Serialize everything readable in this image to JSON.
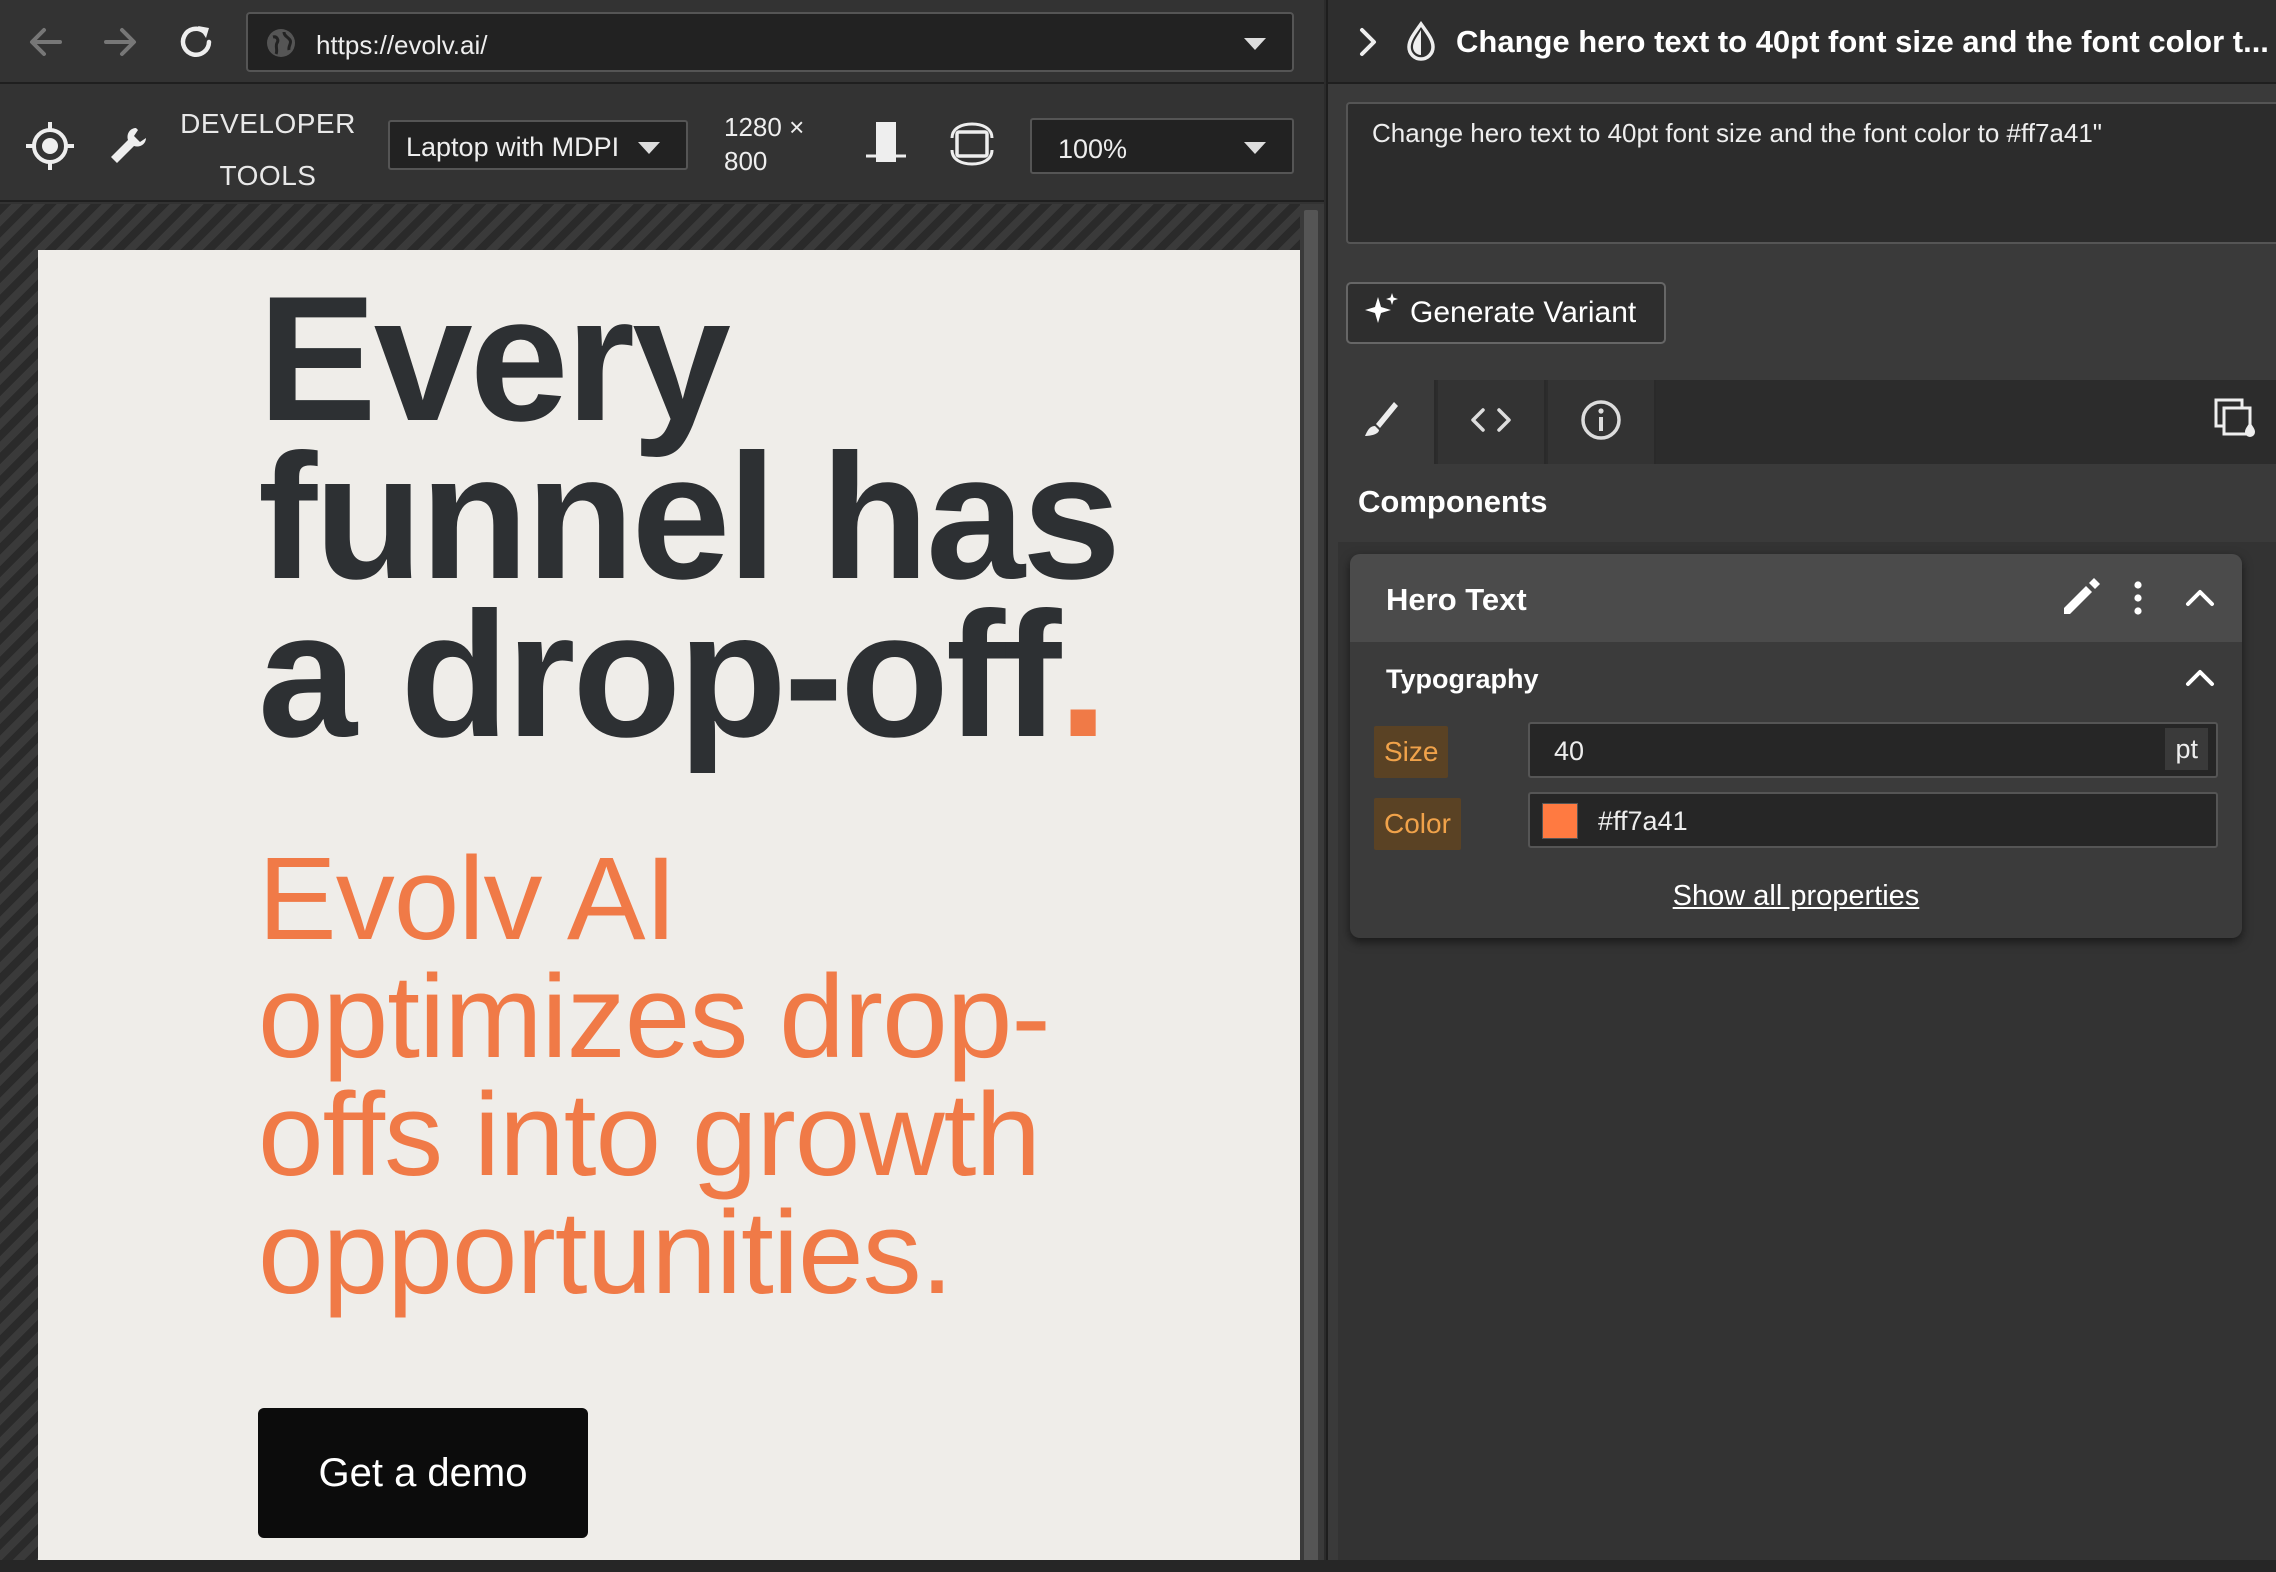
{
  "browser": {
    "url": "https://evolv.ai/"
  },
  "devtools": {
    "title_line1": "DEVELOPER",
    "title_line2": "TOOLS",
    "device": "Laptop with MDPI",
    "width": "1280 ×",
    "height": "800",
    "zoom": "100%"
  },
  "hero": {
    "headline_line1": "Every",
    "headline_line2": "funnel has",
    "headline_line3": "a drop-off",
    "headline_dot": ".",
    "subhead_line1": "Evolv AI",
    "subhead_line2": "optimizes drop-",
    "subhead_line3": "offs into growth",
    "subhead_line4": "opportunities.",
    "cta": "Get a demo"
  },
  "panel": {
    "title": "Change hero text to 40pt font size and the font color t...",
    "prompt": "Change hero text to 40pt font size and the font color to #ff7a41\"",
    "generate_label": "Generate Variant",
    "components_heading": "Components",
    "component": {
      "name": "Hero Text",
      "section": "Typography",
      "size_label": "Size",
      "size_value": "40",
      "size_unit": "pt",
      "color_label": "Color",
      "color_value": "#ff7a41",
      "show_all": "Show all properties"
    }
  },
  "colors": {
    "accent": "#f07a47",
    "swatch": "#ff7a41",
    "headline": "#2d3033",
    "page_bg": "#efede9"
  },
  "icons": [
    "back-arrow-icon",
    "forward-arrow-icon",
    "reload-icon",
    "globe-icon",
    "crosshair-icon",
    "wrench-icon",
    "portrait-icon",
    "rotate-icon",
    "chevron-right-icon",
    "drop-icon",
    "sparkle-icon",
    "brush-icon",
    "code-icon",
    "info-icon",
    "copy-style-icon",
    "pencil-icon",
    "kebab-icon",
    "chevron-up-icon"
  ]
}
